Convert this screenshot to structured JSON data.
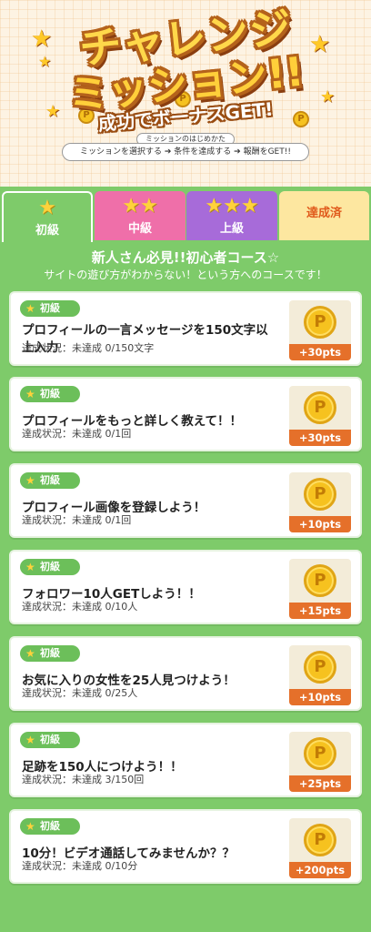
{
  "header": {
    "title_line1": "チャレンジ",
    "title_line2": "ミッション!!",
    "subtitle": "成功でボーナスGET!",
    "howto_label": "ミッションのはじめかた",
    "howto_steps": "ミッションを選択する ➔ 条件を達成する ➔ 報酬をGET!!"
  },
  "tabs": [
    {
      "label": "初級",
      "stars": "★"
    },
    {
      "label": "中級",
      "stars": "★★"
    },
    {
      "label": "上級",
      "stars": "★★★"
    },
    {
      "label": "達成済",
      "stars": ""
    }
  ],
  "course": {
    "title": "新人さん必見!!初心者コース☆",
    "description": "サイトの遊び方がわからない！という方へのコースです！"
  },
  "missions": [
    {
      "level": "初級",
      "title": "プロフィールの一言メッセージを150文字以上入力",
      "status": "達成状況：未達成 0/150文字",
      "reward": "+30pts"
    },
    {
      "level": "初級",
      "title": "プロフィールをもっと詳しく教えて！！",
      "status": "達成状況：未達成 0/1回",
      "reward": "+30pts"
    },
    {
      "level": "初級",
      "title": "プロフィール画像を登録しよう！",
      "status": "達成状況：未達成 0/1回",
      "reward": "+10pts"
    },
    {
      "level": "初級",
      "title": "フォロワー10人GETしよう！！",
      "status": "達成状況：未達成 0/10人",
      "reward": "+15pts"
    },
    {
      "level": "初級",
      "title": "お気に入りの女性を25人見つけよう！",
      "status": "達成状況：未達成 0/25人",
      "reward": "+10pts"
    },
    {
      "level": "初級",
      "title": "足跡を150人につけよう！！",
      "status": "達成状況：未達成 3/150回",
      "reward": "+25pts"
    },
    {
      "level": "初級",
      "title": "10分！ビデオ通話してみませんか？？",
      "status": "達成状況：未達成 0/10分",
      "reward": "+200pts"
    }
  ],
  "coin_symbol": "P",
  "colors": {
    "background_green": "#7ecb6a",
    "tab_middle": "#ef6fa9",
    "tab_advanced": "#a76bd9",
    "tab_done": "#fde7a0",
    "reward_orange": "#e5702a",
    "coin_gold": "#f6c21f"
  }
}
